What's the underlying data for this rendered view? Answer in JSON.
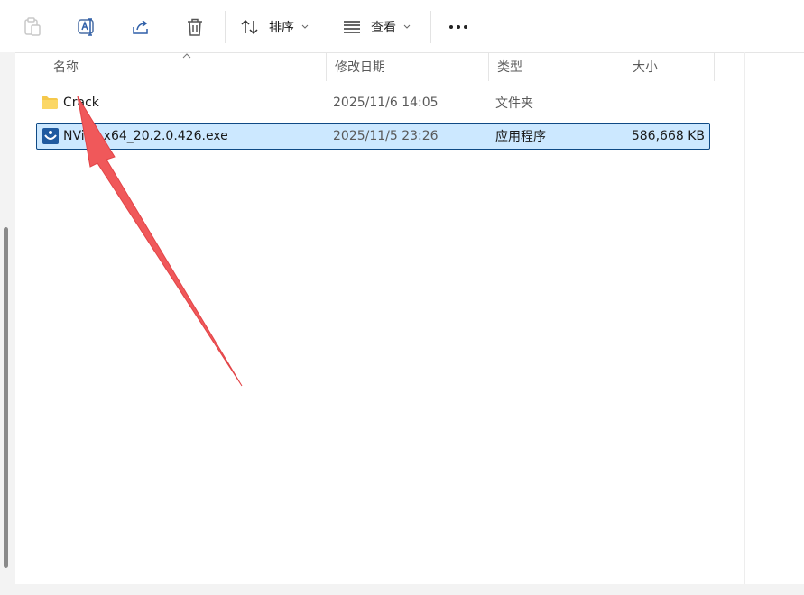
{
  "toolbar": {
    "sort_label": "排序",
    "view_label": "查看"
  },
  "columns": {
    "name": "名称",
    "modified": "修改日期",
    "type": "类型",
    "size": "大小"
  },
  "files": [
    {
      "name": "Crack",
      "modified": "2025/11/6 14:05",
      "type": "文件夹",
      "size": "",
      "icon": "folder-icon",
      "selected": false
    },
    {
      "name": "NVivo.x64_20.2.0.426.exe",
      "modified": "2025/11/5 23:26",
      "type": "应用程序",
      "size": "586,668 KB",
      "icon": "installer-icon",
      "selected": true
    }
  ],
  "colors": {
    "selection_bg": "#cce8ff",
    "selection_border": "#0f4a85",
    "annotation_arrow": "#f0585a",
    "folder": "#f5c84b"
  }
}
